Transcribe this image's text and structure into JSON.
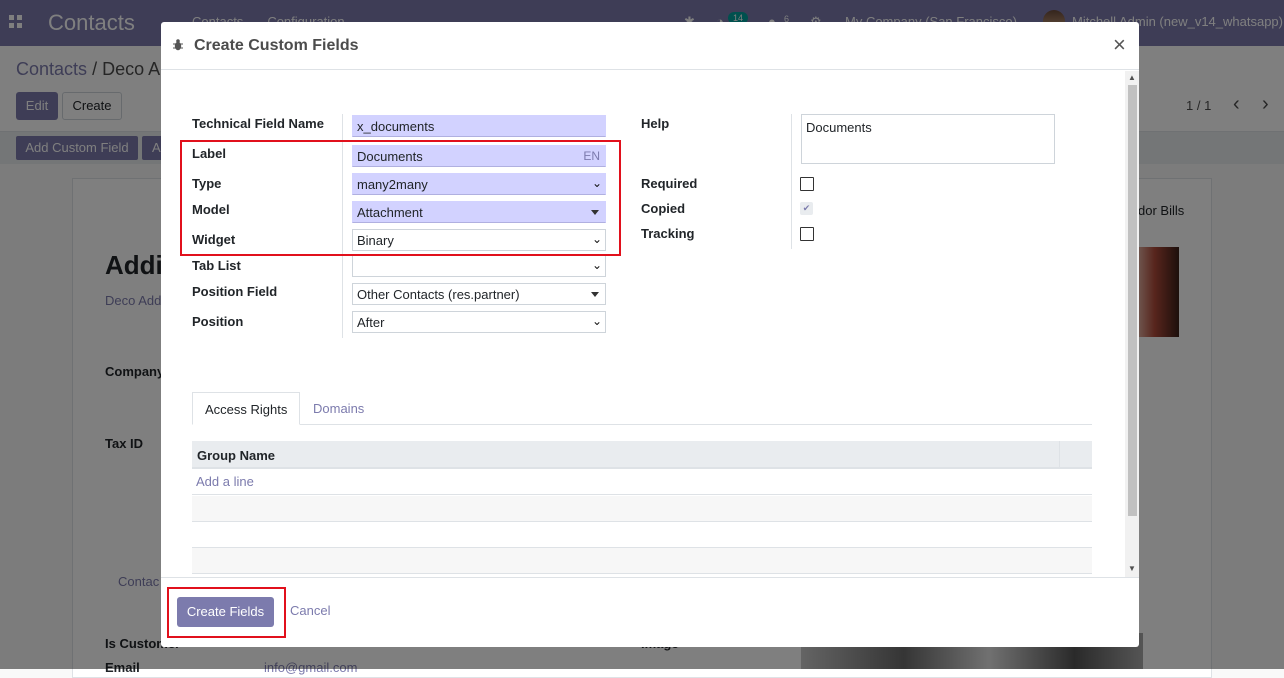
{
  "app": {
    "brand": "Contacts",
    "menu": [
      "Contacts",
      "Configuration"
    ],
    "activity_count": "14",
    "message_count": "6",
    "company": "My Company (San Francisco)",
    "user": "Mitchell Admin (new_v14_whatsapp)"
  },
  "background": {
    "breadcrumb_root": "Contacts",
    "breadcrumb_sep": "/",
    "breadcrumb_current": "Deco A",
    "edit_label": "Edit",
    "create_label": "Create",
    "pager": "1 / 1",
    "add_custom_field": "Add Custom Field",
    "add_other": "A",
    "record_title": "Addi",
    "record_subtitle": "Deco Add",
    "company_label": "Company",
    "taxid_label": "Tax ID",
    "contact_tab": "Contac",
    "vendor_bills": "dor Bills",
    "is_customer": "Is Customer",
    "email_label": "Email",
    "email_value": "info@gmail.com",
    "image_label": "Image"
  },
  "modal": {
    "title": "Create Custom Fields",
    "fields": {
      "technical_name": {
        "label": "Technical Field Name",
        "value": "x_documents"
      },
      "label": {
        "label": "Label",
        "value": "Documents",
        "lang": "EN"
      },
      "type": {
        "label": "Type",
        "value": "many2many"
      },
      "model": {
        "label": "Model",
        "value": "Attachment"
      },
      "widget": {
        "label": "Widget",
        "value": "Binary"
      },
      "tab_list": {
        "label": "Tab List",
        "value": ""
      },
      "position_field": {
        "label": "Position Field",
        "value": "Other Contacts (res.partner)"
      },
      "position": {
        "label": "Position",
        "value": "After"
      }
    },
    "right_fields": {
      "help": {
        "label": "Help",
        "value": "Documents"
      },
      "required": {
        "label": "Required",
        "checked": false
      },
      "copied": {
        "label": "Copied",
        "checked": true
      },
      "tracking": {
        "label": "Tracking",
        "checked": false
      }
    },
    "tabs": [
      {
        "label": "Access Rights",
        "active": true
      },
      {
        "label": "Domains",
        "active": false
      }
    ],
    "table": {
      "header": "Group Name",
      "add_line": "Add a line"
    },
    "footer": {
      "create_label": "Create Fields",
      "cancel_label": "Cancel"
    }
  },
  "colors": {
    "brand": "#7c7bad",
    "required_field": "#d2d2ff",
    "highlight_box": "#e1101c"
  }
}
